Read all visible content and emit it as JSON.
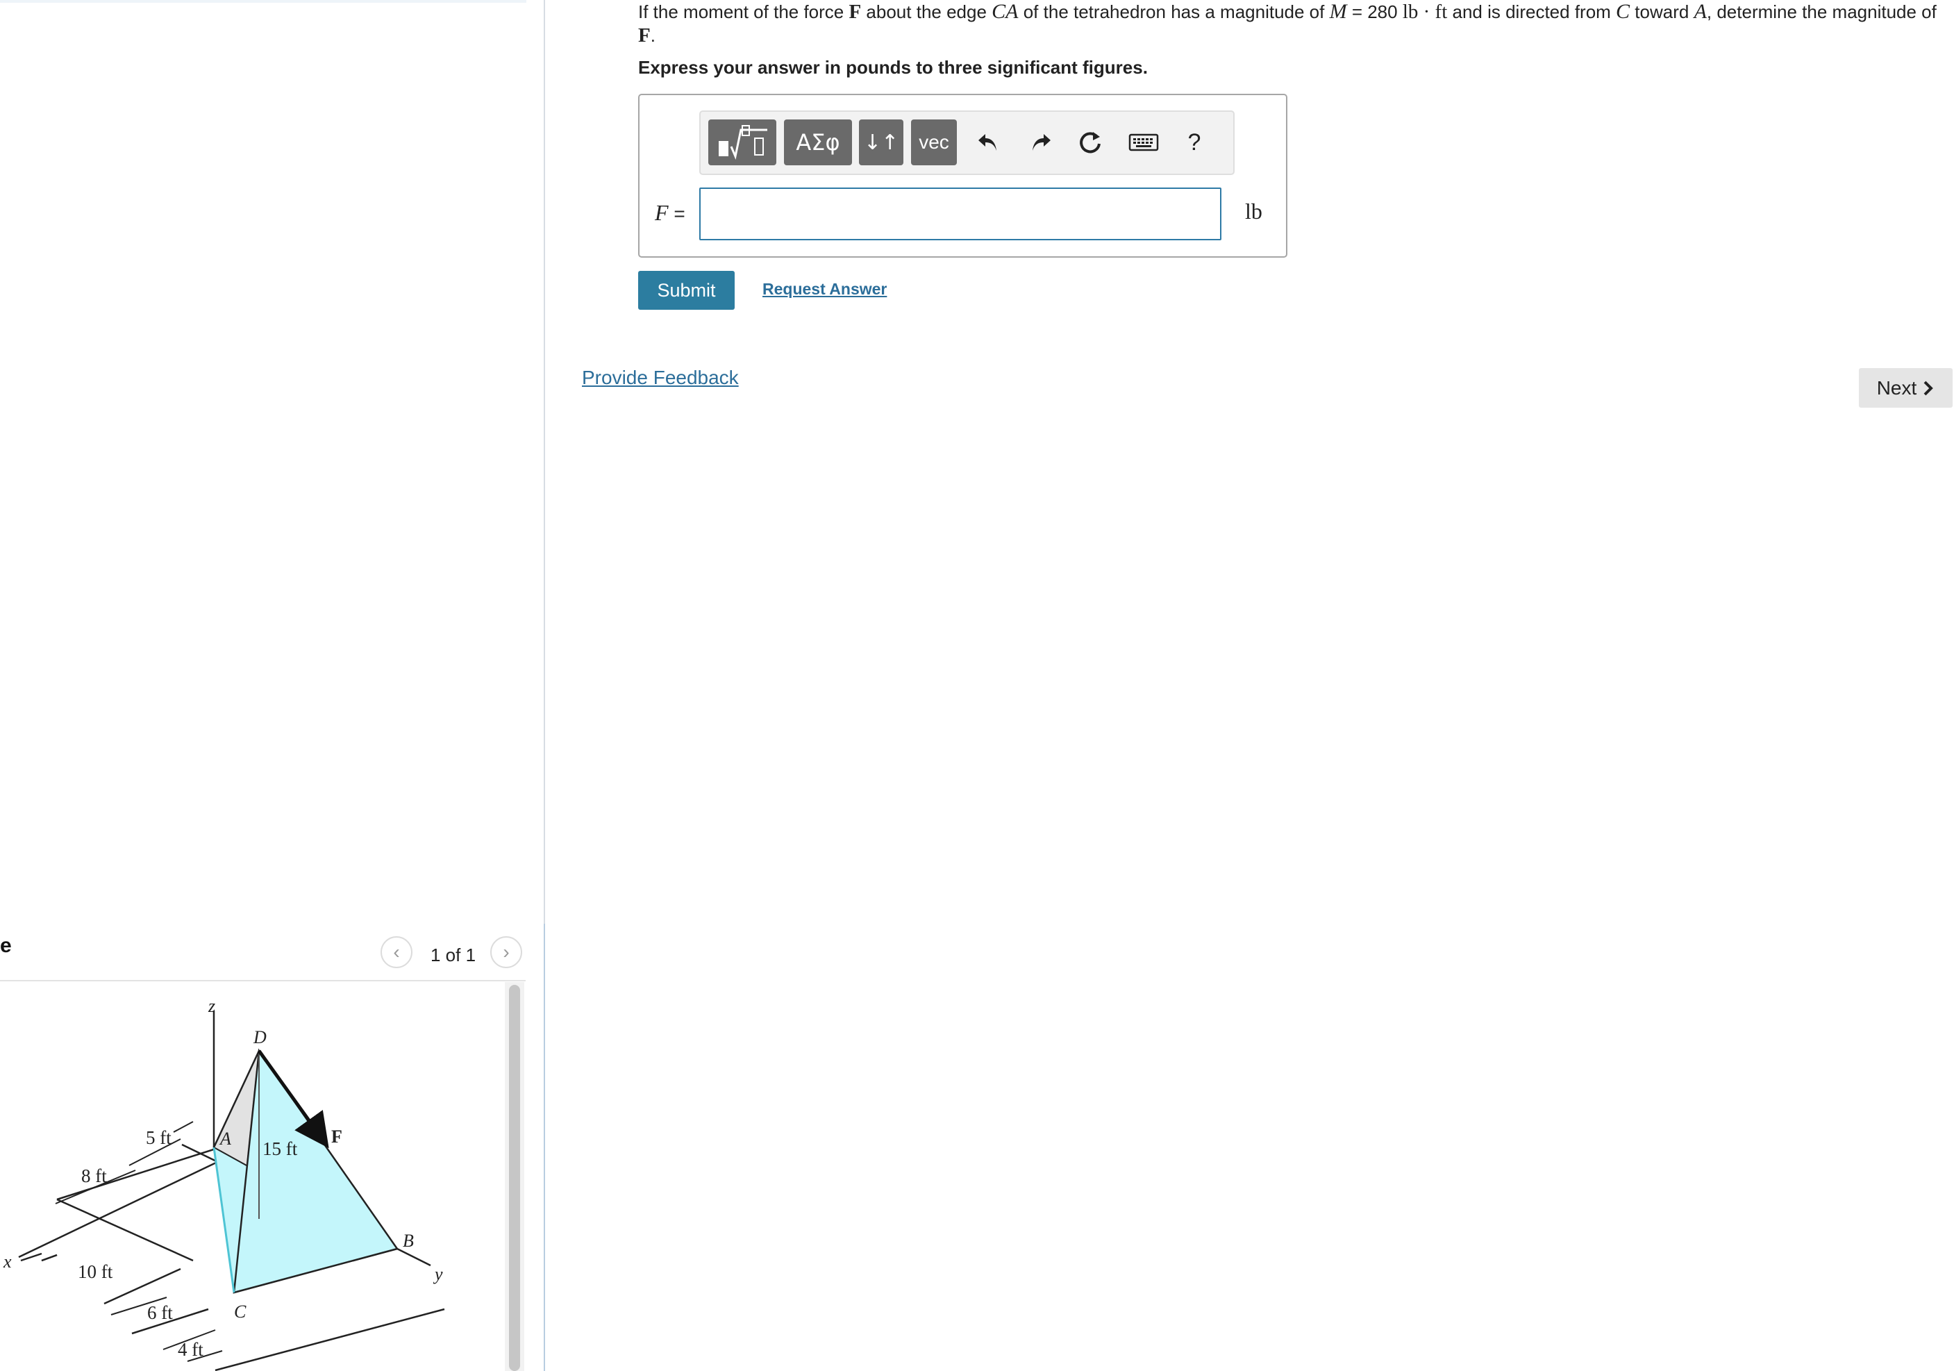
{
  "question": {
    "part1": "If the moment of the force ",
    "force_symbol": "F",
    "part2": " about the edge ",
    "edge": "CA",
    "part3": " of the tetrahedron has a magnitude of ",
    "moment_symbol": "M",
    "moment_eq": " = 280 ",
    "moment_unit": "lb · ft",
    "part4": " and is directed from ",
    "from_point": "C",
    "part5": " toward ",
    "to_point": "A",
    "part6": ", determine the magnitude of ",
    "force_symbol2": "F",
    "end": "."
  },
  "instruction": "Express your answer in pounds to three significant figures.",
  "toolbar": {
    "templates_icon": "fraction-sqrt-templates-icon",
    "greek_label": "ΑΣφ",
    "arrows_label": "↓↑",
    "vec_label": "vec",
    "help_label": "?"
  },
  "answer": {
    "variable": "F",
    "equals": " =",
    "value": "",
    "unit": "lb"
  },
  "actions": {
    "submit_label": "Submit",
    "request_label": "Request Answer",
    "feedback_label": "Provide Feedback",
    "next_label": "Next"
  },
  "figure": {
    "header": "e",
    "pager": "1 of 1",
    "labels": {
      "z": "z",
      "x": "x",
      "y": "y",
      "D": "D",
      "A": "A",
      "B": "B",
      "C": "C",
      "F": "F",
      "d15": "15 ft",
      "d5": "5 ft",
      "d8": "8 ft",
      "d10": "10 ft",
      "d6": "6 ft",
      "d4": "4 ft"
    }
  },
  "colors": {
    "accent": "#2c7da0",
    "link": "#2c6e9a",
    "tetra_fill": "#c4f6fb",
    "tetra_shadow": "#e2e2e2"
  }
}
